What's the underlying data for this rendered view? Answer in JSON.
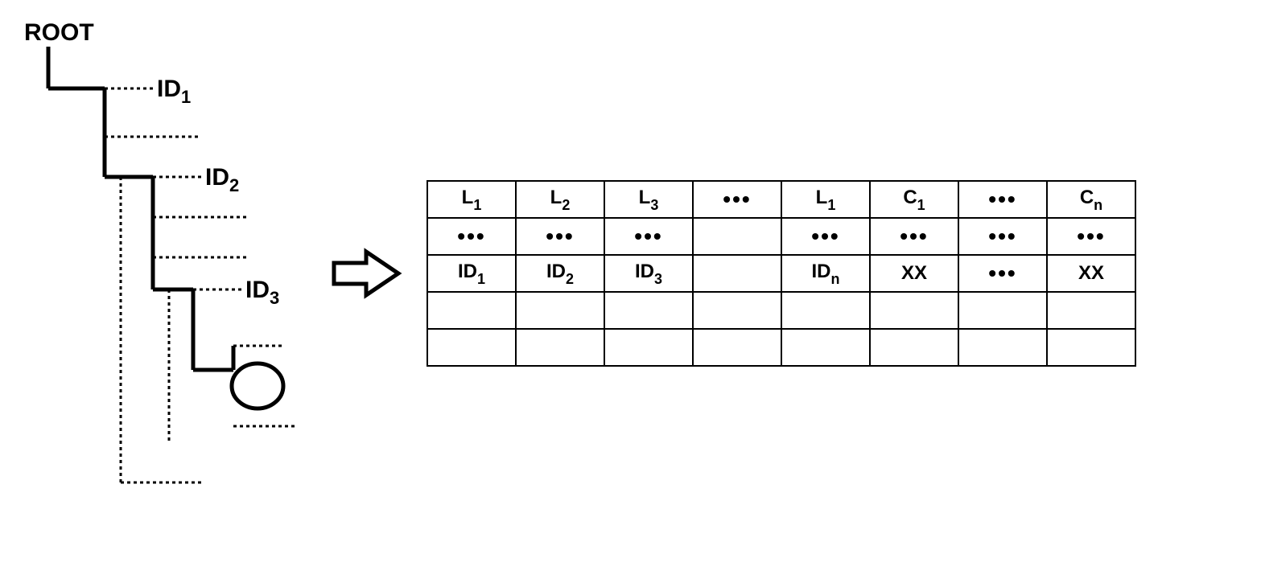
{
  "tree": {
    "root": "ROOT",
    "nodes": [
      {
        "label": "ID",
        "sub": "1"
      },
      {
        "label": "ID",
        "sub": "2"
      },
      {
        "label": "ID",
        "sub": "3"
      }
    ]
  },
  "table": {
    "rows": [
      [
        {
          "t": "L",
          "s": "1"
        },
        {
          "t": "L",
          "s": "2"
        },
        {
          "t": "L",
          "s": "3"
        },
        {
          "d": true
        },
        {
          "t": "L",
          "s": "1"
        },
        {
          "t": "C",
          "s": "1"
        },
        {
          "d": true
        },
        {
          "t": "C",
          "s": "n"
        }
      ],
      [
        {
          "d": true
        },
        {
          "d": true
        },
        {
          "d": true
        },
        {
          "e": true
        },
        {
          "d": true
        },
        {
          "d": true
        },
        {
          "d": true
        },
        {
          "d": true
        }
      ],
      [
        {
          "t": "ID",
          "s": "1"
        },
        {
          "t": "ID",
          "s": "2"
        },
        {
          "t": "ID",
          "s": "3"
        },
        {
          "e": true
        },
        {
          "t": "ID",
          "s": "n"
        },
        {
          "t": "XX"
        },
        {
          "d": true
        },
        {
          "t": "XX"
        }
      ],
      [
        {
          "e": true
        },
        {
          "e": true
        },
        {
          "e": true
        },
        {
          "e": true
        },
        {
          "e": true
        },
        {
          "e": true
        },
        {
          "e": true
        },
        {
          "e": true
        }
      ],
      [
        {
          "e": true
        },
        {
          "e": true
        },
        {
          "e": true
        },
        {
          "e": true
        },
        {
          "e": true
        },
        {
          "e": true
        },
        {
          "e": true
        },
        {
          "e": true
        }
      ]
    ]
  }
}
